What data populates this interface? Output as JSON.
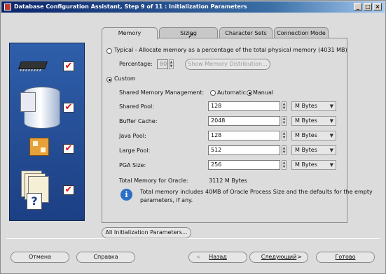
{
  "window": {
    "title": "Database Configuration Assistant, Step 9 of 11 : Initialization Parameters",
    "controls": [
      "_",
      "□",
      "×"
    ]
  },
  "tabs": [
    {
      "label": "Memory",
      "active": true
    },
    {
      "label": "Sizing",
      "active": false
    },
    {
      "label": "Character Sets",
      "active": false
    },
    {
      "label": "Connection Mode",
      "active": false
    }
  ],
  "typical": {
    "label": "Typical - Allocate memory as a percentage of the total physical memory (4031 MB)",
    "selected": false,
    "percentage_label": "Percentage:",
    "percentage_value": "80",
    "show_button": "Show Memory Distribution..."
  },
  "custom": {
    "label": "Custom",
    "selected": true,
    "smm_label": "Shared Memory Management:",
    "smm_auto": "Automatic",
    "smm_manual": "Manual",
    "smm_selected": "Manual",
    "rows": [
      {
        "label": "Shared Pool:",
        "value": "128",
        "unit": "M Bytes"
      },
      {
        "label": "Buffer Cache:",
        "value": "2048",
        "unit": "M Bytes"
      },
      {
        "label": "Java Pool:",
        "value": "128",
        "unit": "M Bytes"
      },
      {
        "label": "Large Pool:",
        "value": "512",
        "unit": "M Bytes"
      },
      {
        "label": "PGA Size:",
        "value": "256",
        "unit": "M Bytes"
      }
    ],
    "total_label": "Total Memory for Oracle:",
    "total_value": "3112 M Bytes",
    "info_text_line1": "Total memory includes 40MB of Oracle Process Size and the defaults for the empty",
    "info_text_line2": "parameters, if any."
  },
  "all_params_button": "All Initialization Parameters...",
  "footer": {
    "cancel": "Отмена",
    "help": "Справка",
    "back_arrow": "<",
    "back": "Назад",
    "next": "Следующий",
    "next_arrow": ">",
    "finish": "Готово"
  },
  "icons": {
    "info": "i",
    "question": "?",
    "check": "✔",
    "spin_up": "▲",
    "spin_down": "▼",
    "caret": "▼"
  }
}
